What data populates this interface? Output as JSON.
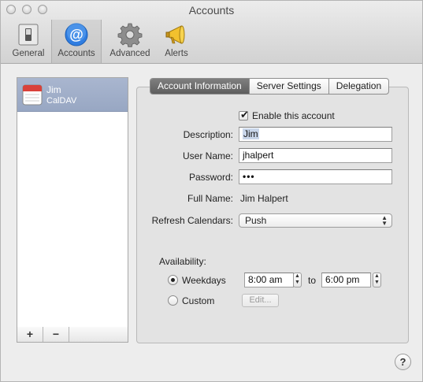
{
  "window": {
    "title": "Accounts"
  },
  "toolbar": {
    "general": "General",
    "accounts": "Accounts",
    "advanced": "Advanced",
    "alerts": "Alerts"
  },
  "accounts_list": {
    "items": [
      {
        "name": "Jim",
        "type": "CalDAV"
      }
    ],
    "add_label": "+",
    "remove_label": "−"
  },
  "tabs": {
    "account_info": "Account Information",
    "server_settings": "Server Settings",
    "delegation": "Delegation"
  },
  "form": {
    "enable_label": "Enable this account",
    "enable_checked": true,
    "description_label": "Description:",
    "description_value": "Jim",
    "username_label": "User Name:",
    "username_value": "jhalpert",
    "password_label": "Password:",
    "password_value": "•••",
    "fullname_label": "Full Name:",
    "fullname_value": "Jim Halpert",
    "refresh_label": "Refresh Calendars:",
    "refresh_value": "Push",
    "availability_label": "Availability:",
    "weekdays_label": "Weekdays",
    "weekdays_selected": true,
    "start_time": "8:00 am",
    "to_label": "to",
    "end_time": "6:00 pm",
    "custom_label": "Custom",
    "edit_button": "Edit..."
  },
  "help": {
    "label": "?"
  },
  "colors": {
    "selection_row": "#9eadc9",
    "active_tab": "#6a6a6a",
    "accounts_icon": "#2f7de1"
  }
}
